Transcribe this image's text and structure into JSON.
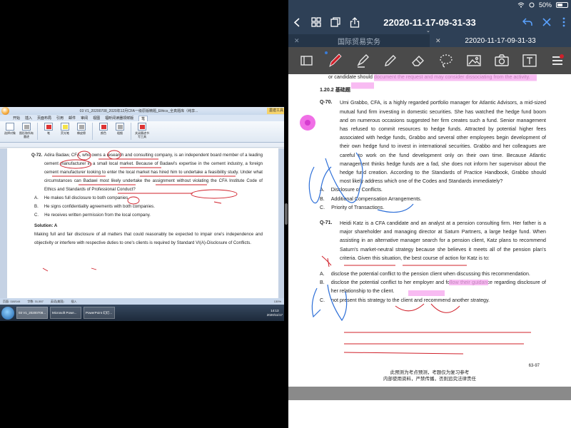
{
  "word": {
    "title_text": "03 V1_20200708_2020年12月CFA一级原版精题_Ethics_全真题库（纯享...",
    "context_tab": "墨迹工具",
    "menu": [
      "开始",
      "插入",
      "页面布局",
      "引用",
      "邮件",
      "审阅",
      "视图",
      "福昕阅读器领鲜版",
      "笔"
    ],
    "active_menu": "笔",
    "ribbon": [
      {
        "label": "选择对象",
        "icon": "select"
      },
      {
        "label": "图形和所有墨迹",
        "icon": "grey"
      },
      {
        "label": "笔",
        "icon": "red"
      },
      {
        "label": "荧光笔",
        "icon": "yellow"
      },
      {
        "label": "橡皮擦",
        "icon": "grey"
      },
      {
        "label": "颜色",
        "icon": "red"
      },
      {
        "label": "粗细",
        "icon": "grey"
      },
      {
        "label": "关闭墨迹书写工具",
        "icon": "red"
      }
    ],
    "q72_num": "Q-72.",
    "q72_text": "Adira Badaw, CFA, who owns a research and consulting company, is an independent board member of a leading cement manufacturer in a small local market. Because of Badawi's expertise in the cement industry, a foreign cement manufacturer looking to enter the local market has hired him to undertake a feasibility study. Under what circumstances can Badawi most likely undertake the assignment without violating the CFA Institute Code of Ethics and Standards of Professional Conduct?",
    "options": [
      {
        "letter": "A.",
        "text": "He makes full disclosure to both companies."
      },
      {
        "letter": "B.",
        "text": "He signs confidentiality agreements with both companies."
      },
      {
        "letter": "C.",
        "text": "He receives written permission from the local company."
      }
    ],
    "solution_label": "Solution: A",
    "solution_text": "Making full and fair disclosure of all matters that could reasonably be expected to impair one's independence and objectivity or interfere with respective duties to one's clients is required by Standard VI(A)-Disclosure of Conflicts.",
    "status_page": "页面: 118/144",
    "status_words": "字数: 31,557",
    "status_lang": "英语(美国)",
    "status_mode": "插入",
    "status_zoom": "130%",
    "taskbar_items": [
      "03 V1_20200708...",
      "Microsoft Powe...",
      "PowerPoint 幻灯..."
    ],
    "tray_time": "14:13",
    "tray_date": "2020/11/17"
  },
  "app": {
    "battery": "50%",
    "title": "22020-11-17-09-31-33",
    "tabs": [
      {
        "label": "国际贸易实务",
        "active": false
      },
      {
        "label": "22020-11-17-09-31-33",
        "active": true
      }
    ]
  },
  "pdf": {
    "prev_text": "or candidate should document the request and may consider dissociating from the activity.",
    "section": "1.20.2   基础题",
    "q70_num": "Q-70.",
    "q70_text": "Umi Grabbo, CFA, is a highly regarded portfolio manager for Atlantic Advisors, a mid-sized mutual fund firm investing in domestic securities. She has watched the hedge fund boom and on numerous occasions suggested her firm creates such a fund. Senior management has refused to commit resources to hedge funds. Attracted by potential higher fees associated with hedge funds, Grabbo and several other employees begin development of their own hedge fund to invest in international securities. Grabbo and her colleagues are careful to work on the fund development only on their own time. Because Atlantic management thinks hedge funds are a fad, she does not inform her supervisor about the hedge fund creation. According to the Standards of Practice Handbook, Grabbo should most likely address which one of the Codes and Standards immediately?",
    "q70_options": [
      {
        "letter": "A.",
        "text": "Disclosure of Conflicts."
      },
      {
        "letter": "B.",
        "text": "Additional Compensation Arrangements."
      },
      {
        "letter": "C.",
        "text": "Priority of Transactions."
      }
    ],
    "q71_num": "Q-71.",
    "q71_text": "Heidi Katz is a CFA candidate and an analyst at a pension consulting firm. Her father is a major shareholder and managing director at Saturn Partners, a large hedge fund. When assisting in an alternative manager search for a pension client, Katz plans to recommend Saturn's market-neutral strategy because she believes it meets all of the pension plan's criteria. Given this situation, the best course of action for Katz is to:",
    "q71_options": [
      {
        "letter": "A.",
        "text": "disclose the potential conflict to the pension client when discussing this recommendation."
      },
      {
        "letter": "B.",
        "text": "disclose the potential conflict to her employer and follow their guidance regarding disclosure of her relationship to the client."
      },
      {
        "letter": "C.",
        "text": "not present this strategy to the client and recommend another strategy."
      }
    ],
    "page_num": "63-97",
    "footer_line1": "此预测为考点预测，考题仅为复习参考",
    "footer_line2": "内部使用资料，严禁传播，否则追究法律责任"
  },
  "colors": {
    "nav_bg": "#2e4056",
    "toolbar_bg": "#4a4a4a",
    "ink_red": "#d0202a",
    "ink_blue": "#2d6fd8",
    "highlight_pink": "#f6a4ee"
  }
}
